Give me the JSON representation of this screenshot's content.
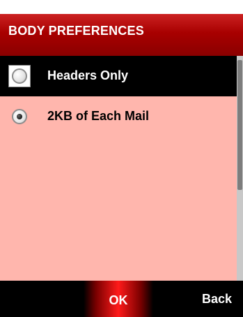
{
  "header": {
    "title": "BODY PREFERENCES"
  },
  "options": [
    {
      "label": "Headers Only",
      "selected": true
    },
    {
      "label": "2KB of Each Mail",
      "selected": false
    }
  ],
  "softkeys": {
    "ok": "OK",
    "back": "Back"
  },
  "colors": {
    "header": "#a80000",
    "list_background": "#ffb6ad",
    "selected_row": "#000000",
    "softkey_bar": "#000000",
    "softkey_highlight": "#ff1a1a"
  }
}
